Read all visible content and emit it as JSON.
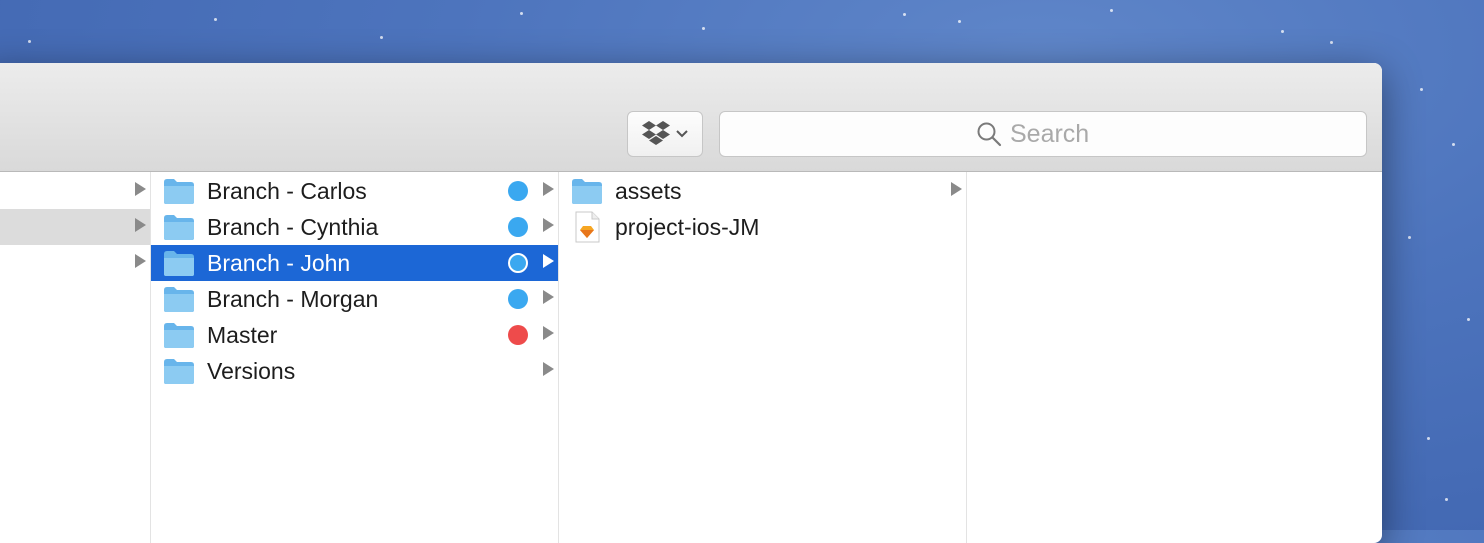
{
  "toolbar": {
    "dropbox_menu_icon": "dropbox-icon",
    "search": {
      "placeholder": "Search",
      "value": ""
    }
  },
  "colors": {
    "selection": "#1c67d6",
    "folder": "#68b5eb",
    "tag_blue": "#3aa8f0",
    "tag_red": "#ee4b4b"
  },
  "column1": {
    "rows": [
      {
        "has_children": true
      },
      {
        "has_children": true,
        "highlighted": true
      },
      {
        "has_children": true
      }
    ]
  },
  "column2": {
    "items": [
      {
        "label": "Branch - Carlos",
        "icon": "folder-icon",
        "tag": "blue"
      },
      {
        "label": "Branch - Cynthia",
        "icon": "folder-icon",
        "tag": "blue"
      },
      {
        "label": "Branch - John",
        "icon": "folder-icon",
        "tag": "blue",
        "selected": true
      },
      {
        "label": "Branch - Morgan",
        "icon": "folder-icon",
        "tag": "blue"
      },
      {
        "label": "Master",
        "icon": "folder-icon",
        "tag": "red"
      },
      {
        "label": "Versions",
        "icon": "folder-icon",
        "tag": null
      }
    ]
  },
  "column3": {
    "items": [
      {
        "label": "assets",
        "icon": "folder-icon",
        "has_children": true
      },
      {
        "label": "project-ios-JM",
        "icon": "sketch-file-icon",
        "has_children": false
      }
    ]
  }
}
